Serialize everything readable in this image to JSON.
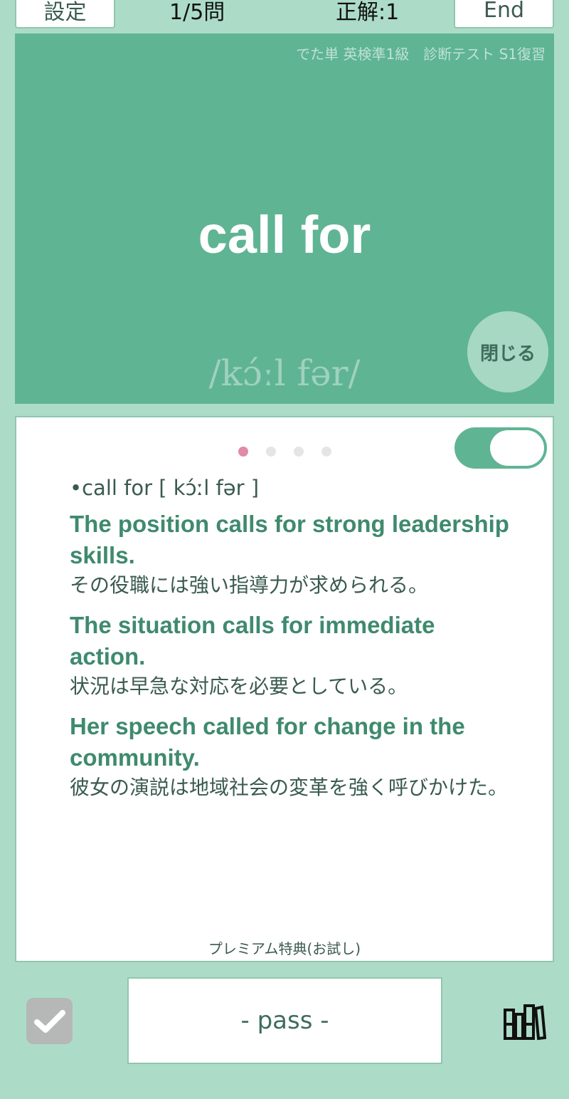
{
  "header": {
    "settings_label": "設定",
    "question_count": "1/5問",
    "correct_count": "正解:1",
    "end_label": "End"
  },
  "card": {
    "deck_name": "でた単 英検準1級　診断テスト S1復習",
    "word": "call for",
    "pronunciation": "/kɔ́ːl fər/",
    "close_label": "閉じる"
  },
  "panel": {
    "page_dots": 4,
    "active_dot": 0,
    "entry_line": "•call for [ kɔ́ːl fər ]",
    "examples": [
      {
        "en": "The position calls for strong leadership skills.",
        "ja": "その役職には強い指導力が求められる。"
      },
      {
        "en": "The situation calls for immediate action.",
        "ja": "状況は早急な対応を必要としている。"
      },
      {
        "en": "Her speech called for change in the community.",
        "ja": "彼女の演説は地域社会の変革を強く呼びかけた。"
      }
    ],
    "premium_label": "プレミアム特典(お試し)",
    "toggle_on": true
  },
  "footer": {
    "pass_label": "- pass -",
    "check_icon": "check-icon",
    "library_icon": "library-icon"
  },
  "colors": {
    "background": "#acdcc8",
    "card": "#5fb494",
    "accent_text": "#3f8a6e",
    "active_dot": "#e18aa9"
  }
}
